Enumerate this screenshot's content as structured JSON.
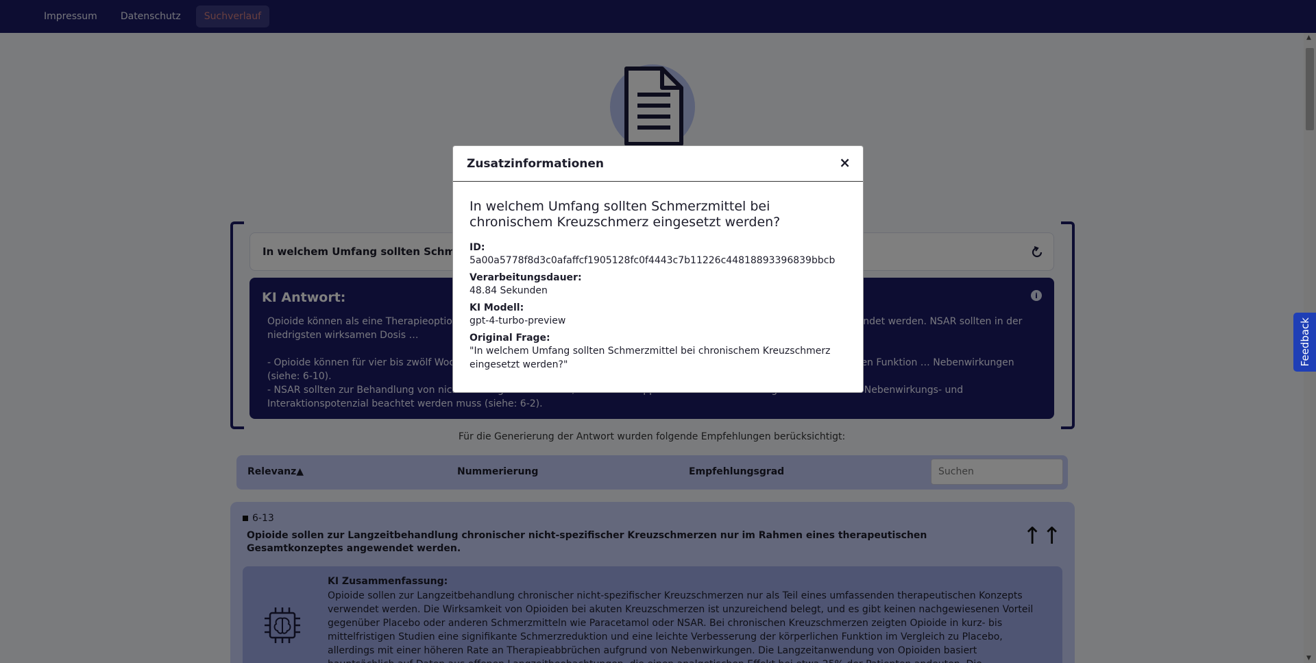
{
  "nav": {
    "items": [
      {
        "label": "Impressum"
      },
      {
        "label": "Datenschutz"
      },
      {
        "label": "Suchverlauf"
      }
    ]
  },
  "query": {
    "text": "In welchem Umfang sollten Schmerzmittel bei chronischem Kreuzschmerz eingesetzt werden?"
  },
  "ki_answer": {
    "title": "KI Antwort:",
    "text": "Opioide können als eine Therapieoption für die Langzeitbehandlung chronischer nicht-spezifischer Kreuzschmerzen angewendet werden. NSAR sollten in der niedrigsten wirksamen Dosis …\n\n- Opioide können für vier bis zwölf Wochen … eine signifikante Schmerzreduktion und eine geringe Zunahme der körperlichen Funktion … Nebenwirkungen (siehe: 6-10).\n- NSAR sollten zur Behandlung von nicht-s… eingesetzt werden, wobei orale Applikationsformen bevorzugt werden und das Nebenwirkungs- und Interaktionspotenzial beachtet werden muss (siehe: 6-2)."
  },
  "considered_text": "Für die Generierung der Antwort wurden folgende Empfehlungen berücksichtigt:",
  "table": {
    "headers": {
      "relevance": "Relevanz▲",
      "numbering": "Nummerierung",
      "grade": "Empfehlungsgrad"
    },
    "search_placeholder": "Suchen"
  },
  "recommendation": {
    "number": "6-13",
    "text": "Opioide sollen zur Langzeitbehandlung chronischer nicht-spezifischer Kreuzschmerzen nur im Rahmen eines therapeutischen Gesamtkonzeptes angewendet werden.",
    "grade_symbol": "↑↑",
    "summary_title": "KI Zusammenfassung:",
    "summary_text": "Opioide sollen zur Langzeitbehandlung chronischer nicht-spezifischer Kreuzschmerzen nur als Teil eines umfassenden therapeutischen Konzepts verwendet werden. Die Wirksamkeit von Opioiden bei akuten Kreuzschmerzen ist unzureichend belegt, und es gibt keinen nachgewiesenen Vorteil gegenüber Placebo oder anderen Schmerzmitteln wie Paracetamol oder NSAR. Bei chronischen Kreuzschmerzen zeigten Opioide in kurz- bis mittelfristigen Studien eine signifikante Schmerzreduktion und eine leichte Verbesserung der körperlichen Funktion im Vergleich zu Placebo, allerdings mit einer höheren Rate an Therapieabbrüchen aufgrund von Nebenwirkungen. Die Langzeitanwendung von Opioiden basiert hauptsächlich auf Daten aus offenen Langzeitbeobachtungen, die einen analgetischen Effekt bei etwa 25% der Patienten andeuten. Die Empfehlung betont die Wichtigkeit der Einbindung von"
  },
  "feedback_label": "Feedback",
  "modal": {
    "title": "Zusatzinformationen",
    "close": "×",
    "question": "In welchem Umfang sollten Schmerzmittel bei chronischem Kreuzschmerz eingesetzt werden?",
    "id_label": "ID:",
    "id_value": "5a00a5778f8d3c0afaffcf1905128fc0f4443c7b11226c44818893396839bbcb",
    "duration_label": "Verarbeitungsdauer:",
    "duration_value": "48.84 Sekunden",
    "model_label": "KI Modell:",
    "model_value": "gpt-4-turbo-preview",
    "original_label": "Original Frage:",
    "original_value": "\"In welchem Umfang sollten Schmerzmittel bei chronischem Kreuzschmerz eingesetzt werden?\""
  }
}
